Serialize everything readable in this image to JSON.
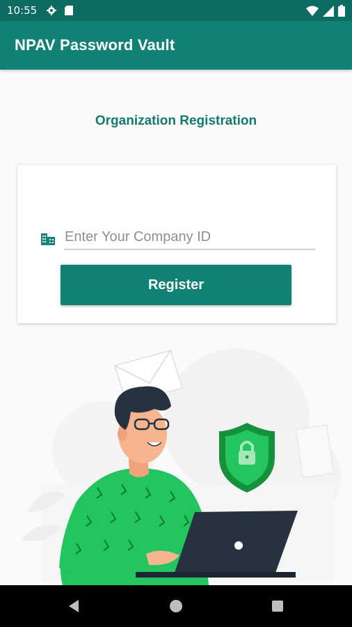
{
  "status_bar": {
    "time": "10:55",
    "icons_left": [
      "settings-icon",
      "sd-card-icon"
    ],
    "icons_right": [
      "wifi-icon",
      "signal-icon",
      "battery-icon"
    ]
  },
  "app_bar": {
    "title": "NPAV Password Vault"
  },
  "page": {
    "section_title": "Organization Registration"
  },
  "form": {
    "company_id_placeholder": "Enter Your Company ID",
    "company_id_value": "",
    "register_label": "Register"
  },
  "illustration": {
    "description_icon": "security-shield-lock-illustration"
  },
  "nav_bar": {
    "buttons": [
      "back-icon",
      "home-icon",
      "recents-icon"
    ]
  },
  "colors": {
    "status_bar": "#0e6b62",
    "app_bar": "#128276",
    "accent": "#137a6f",
    "button": "#0f8274",
    "shirt": "#22c55e",
    "shield": "#16a34a"
  }
}
